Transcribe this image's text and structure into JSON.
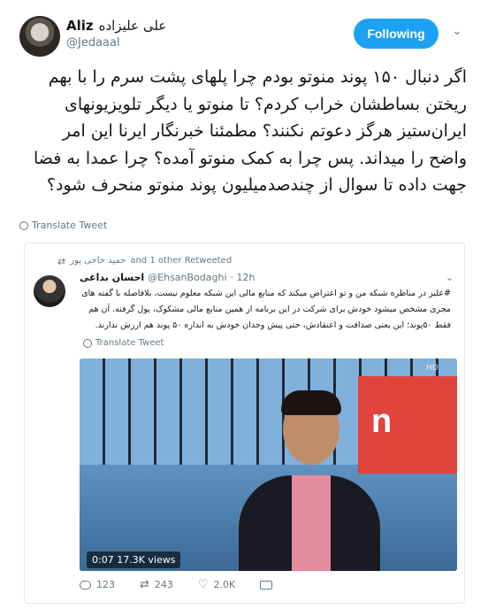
{
  "author": {
    "name_en": "Aliz",
    "name_fa": "علی علیزاده",
    "handle": "@Jedaaal"
  },
  "follow_button": "Following",
  "tweet_text": "اگر دنبال ۱۵۰ پوند منوتو بودم چرا پلهای پشت سرم را با بهم ریختن بساطشان خراب کردم؟ تا منوتو یا دیگر تلویزیونهای ایران‌ستیز هرگز دعوتم نکنند؟ مطمئنا خبرنگار ایرنا این امر واضح را میداند. پس چرا به کمک منوتو آمده؟ چرا عمدا به فضا جهت داده تا سوال از چندصدمیلیون پوند منوتو منحرف شود؟",
  "translate_label": "Translate Tweet",
  "quoted": {
    "retweet_line": "and 1 other Retweeted",
    "retweet_name": "حمید حاجی پور",
    "name": "احسان بداغی",
    "handle": "@EhsanBodaghi",
    "time": "· 12h",
    "text": "#علیز در مناظره شبکه من و تو اعتراض میکند که منابع مالی این شبکه معلوم نیست، بلافاصله با گفته های مجری مشخص میشود خودش برای شرکت در این برنامه از همین منابع مالی مشکوک، پول گرفته. آن هم فقط ۵۰پوند؛ این یعنی صداقت و اعتقادش، حتی پیش وجدان خودش به اندازه ۵۰ پوند هم ارزش ندارند.",
    "translate_label": "Translate Tweet",
    "video": {
      "timer": "0:07",
      "views": "17.3K views",
      "channel_text": "n",
      "hd_label": "HD"
    },
    "actions": {
      "replies": "123",
      "retweets": "243",
      "likes": "2.0K"
    }
  }
}
